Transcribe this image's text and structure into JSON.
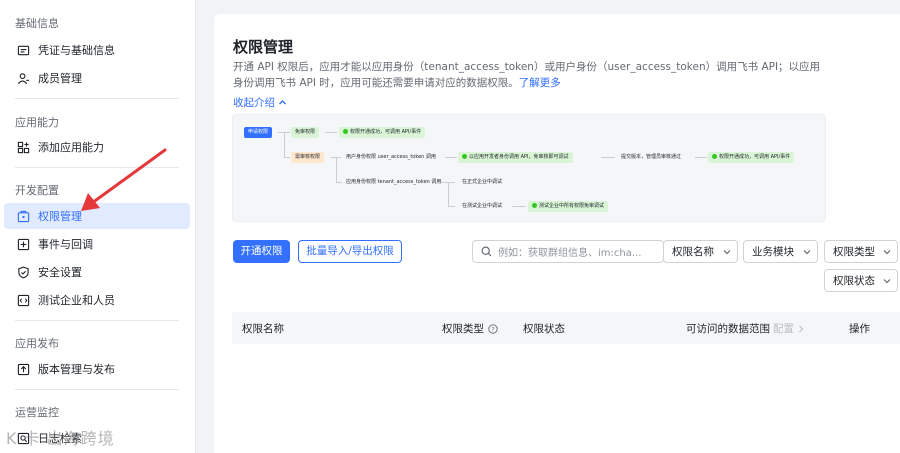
{
  "sidebar": {
    "sections": [
      {
        "title": "基础信息",
        "items": [
          {
            "label": "凭证与基础信息",
            "icon": "credential-icon"
          },
          {
            "label": "成员管理",
            "icon": "member-icon"
          }
        ]
      },
      {
        "title": "应用能力",
        "items": [
          {
            "label": "添加应用能力",
            "icon": "add-capability-icon"
          }
        ]
      },
      {
        "title": "开发配置",
        "items": [
          {
            "label": "权限管理",
            "icon": "permission-icon",
            "active": true
          },
          {
            "label": "事件与回调",
            "icon": "event-icon"
          },
          {
            "label": "安全设置",
            "icon": "shield-icon"
          },
          {
            "label": "测试企业和人员",
            "icon": "code-icon"
          }
        ]
      },
      {
        "title": "应用发布",
        "items": [
          {
            "label": "版本管理与发布",
            "icon": "upload-icon"
          }
        ]
      },
      {
        "title": "运营监控",
        "items": [
          {
            "label": "日志检索",
            "icon": "log-icon"
          }
        ]
      }
    ],
    "watermark": "K 卡 出海跨境"
  },
  "main": {
    "title": "权限管理",
    "description": "开通 API 权限后，应用才能以应用身份（tenant_access_token）或用户身份（user_access_token）调用飞书 API；以应用身份调用飞书 API 时，应用可能还需要申请对应的数据权限。",
    "learn_more": "了解更多",
    "collapse": "收起介绍"
  },
  "flow": {
    "apply": "申请权限",
    "no_review": "免审权限",
    "no_review_result": "权限开通成功，可调用 API/事件",
    "need_review": "需审核权限",
    "user_identity": "用户身份权限 user_access_token 调用",
    "user_identity_result": "以应用开发者身份调用 API，免审核即可调试",
    "submit_version": "提交版本，管理员审核通过",
    "final_result": "权限开通成功，可调用 API/事件",
    "app_identity": "应用身份权限 tenant_access_token 调用",
    "formal_debug": "在正式企业中调试",
    "test_debug": "在测试企业中调试",
    "test_result": "测试企业中所有权限免审调试"
  },
  "toolbar": {
    "enable_button": "开通权限",
    "batch_button": "批量导入/导出权限",
    "search_placeholder": "例如：获取群组信息、im:cha...",
    "filters": [
      "权限名称",
      "业务模块",
      "权限类型",
      "权限状态"
    ]
  },
  "table": {
    "columns": [
      "权限名称",
      "权限类型",
      "权限状态",
      "可访问的数据范围",
      "配置",
      "操作"
    ]
  },
  "colors": {
    "accent": "#3370ff",
    "annotation_arrow": "#e5383b"
  }
}
